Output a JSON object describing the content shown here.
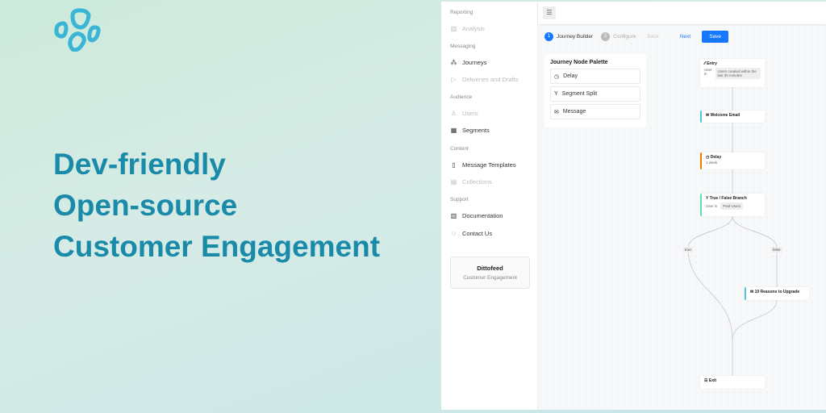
{
  "headline": [
    "Dev-friendly",
    "Open-source",
    "Customer Engagement"
  ],
  "sidebar": {
    "sections": {
      "reporting": "Reporting",
      "messaging": "Messaging",
      "audience": "Audience",
      "content": "Content",
      "support": "Support"
    },
    "items": {
      "analysis": "Analysis",
      "journeys": "Journeys",
      "deliveries": "Deliveries and Drafts",
      "users": "Users",
      "segments": "Segments",
      "templates": "Message Templates",
      "collections": "Collections",
      "documentation": "Documentation",
      "contact": "Contact Us"
    },
    "card": {
      "title": "Dittofeed",
      "subtitle": "Customer Engagement"
    }
  },
  "stepper": {
    "step1_num": "1",
    "step1": "Journey Builder",
    "step2_num": "2",
    "step2": "Configure",
    "back": "Back",
    "next": "Next",
    "save": "Save"
  },
  "palette": {
    "title": "Journey Node Palette",
    "items": [
      "Delay",
      "Segment Split",
      "Message"
    ]
  },
  "nodes": {
    "entry": {
      "title": "Entry",
      "label": "User in",
      "value": "Users created within the last 30 minutes"
    },
    "welcome": {
      "title": "Welcome Email"
    },
    "delay": {
      "title": "Delay",
      "value": "1 week"
    },
    "branch": {
      "title": "True / False Branch",
      "label": "User in",
      "value": "Paid Users"
    },
    "true_label": "true",
    "false_label": "false",
    "reasons": {
      "title": "10 Reasons to Upgrade"
    },
    "exit": {
      "title": "Exit"
    }
  },
  "colors": {
    "accent": "#1677ff",
    "brand": "#1a8aa9",
    "message": "#4ec6e0",
    "delay": "#f07c00",
    "branch": "#5fe0b0"
  }
}
